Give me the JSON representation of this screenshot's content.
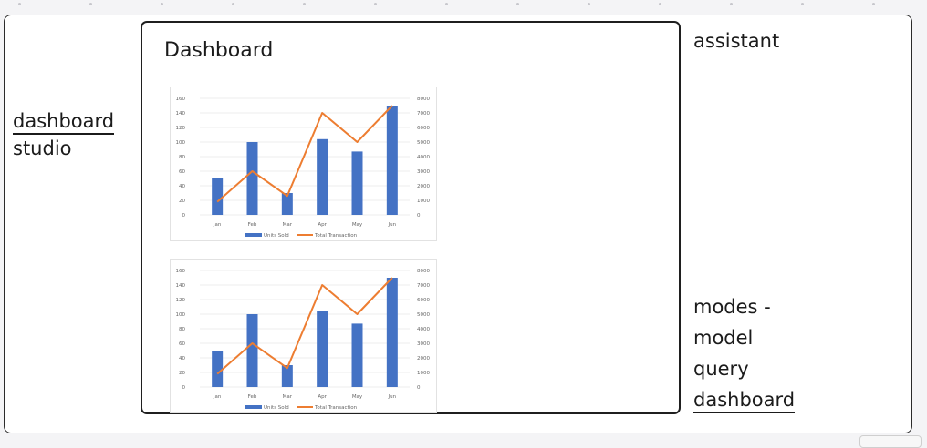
{
  "sidebar": {
    "items": [
      {
        "label": "dashboard",
        "active": true
      },
      {
        "label": "studio",
        "active": false
      }
    ]
  },
  "dashboard": {
    "title": "Dashboard"
  },
  "assistant": {
    "title": "assistant"
  },
  "modes": {
    "title": "modes -",
    "items": [
      {
        "label": "model",
        "active": false
      },
      {
        "label": "query",
        "active": false
      },
      {
        "label": "dashboard",
        "active": true
      }
    ]
  },
  "colors": {
    "bar": "#4472c4",
    "line": "#ed7d31",
    "grid": "#e6e6e6",
    "tick": "#666666"
  },
  "chart_data": [
    {
      "type": "bar",
      "categories": [
        "Jan",
        "Feb",
        "Mar",
        "Apr",
        "May",
        "Jun"
      ],
      "series": [
        {
          "name": "Units Sold",
          "kind": "bar",
          "axis": "left",
          "values": [
            50,
            100,
            30,
            104,
            87,
            150
          ]
        },
        {
          "name": "Total Transaction",
          "kind": "line",
          "axis": "right",
          "values": [
            900,
            3000,
            1300,
            7000,
            5000,
            7500
          ]
        }
      ],
      "ylim": [
        0,
        160
      ],
      "yticks": [
        0,
        20,
        40,
        60,
        80,
        100,
        120,
        140,
        160
      ],
      "y2lim": [
        0,
        8000
      ],
      "y2ticks": [
        0,
        1000,
        2000,
        3000,
        4000,
        5000,
        6000,
        7000,
        8000
      ],
      "grid": true,
      "legend": "bottom"
    },
    {
      "type": "bar",
      "categories": [
        "Jan",
        "Feb",
        "Mar",
        "Apr",
        "May",
        "Jun"
      ],
      "series": [
        {
          "name": "Units Sold",
          "kind": "bar",
          "axis": "left",
          "values": [
            50,
            100,
            30,
            104,
            87,
            150
          ]
        },
        {
          "name": "Total Transaction",
          "kind": "line",
          "axis": "right",
          "values": [
            900,
            3000,
            1300,
            7000,
            5000,
            7500
          ]
        }
      ],
      "ylim": [
        0,
        160
      ],
      "yticks": [
        0,
        20,
        40,
        60,
        80,
        100,
        120,
        140,
        160
      ],
      "y2lim": [
        0,
        8000
      ],
      "y2ticks": [
        0,
        1000,
        2000,
        3000,
        4000,
        5000,
        6000,
        7000,
        8000
      ],
      "grid": true,
      "legend": "bottom"
    }
  ]
}
